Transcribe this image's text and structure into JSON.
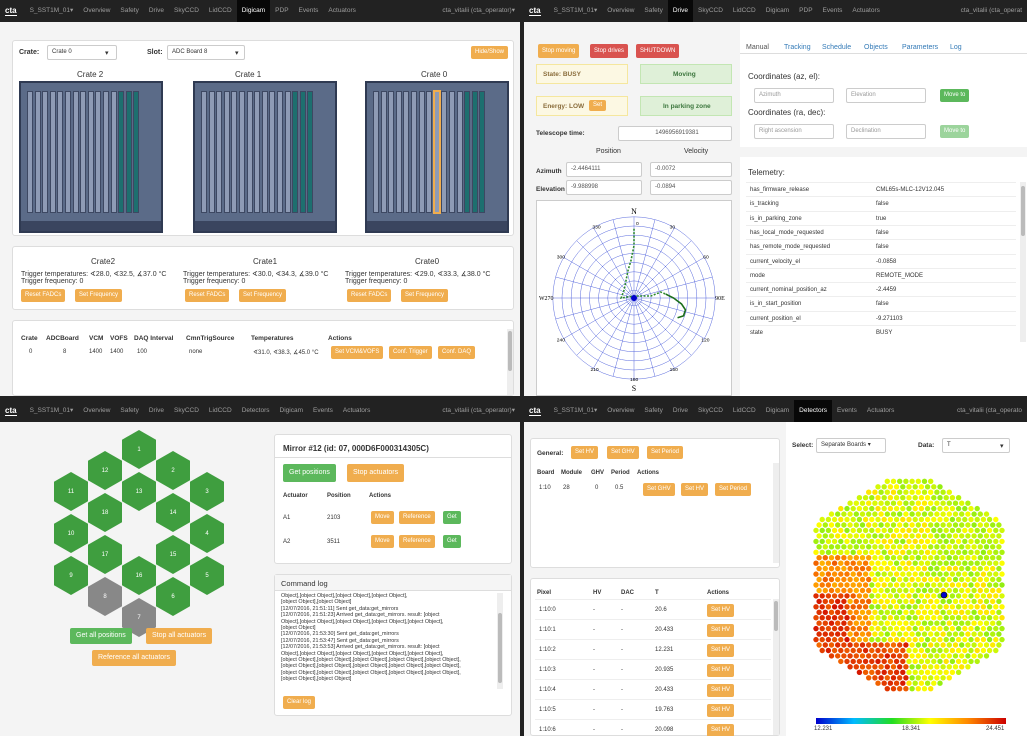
{
  "brand": "cta",
  "q1": {
    "nav": {
      "telescope": "S_SST1M_01▾",
      "items": [
        "Overview",
        "Safety",
        "Drive",
        "SkyCCD",
        "LidCCD",
        "Digicam",
        "PDP",
        "Events",
        "Actuators"
      ],
      "active": "Digicam",
      "user": "cta_vitalii (cta_operator)▾"
    },
    "crate_label": "Crate:",
    "crate_value": "Crate 0",
    "slot_label": "Slot:",
    "slot_value": "ADC Board 8",
    "hide_show": "Hide/Show",
    "crates": [
      "Crate 2",
      "Crate 1",
      "Crate 0"
    ],
    "crate_info": [
      {
        "name": "Crate2",
        "temps": "Trigger temperatures: ∢28.0, ∢32.5, ∡37.0 °C",
        "freq": "Trigger frequency: 0"
      },
      {
        "name": "Crate1",
        "temps": "Trigger temperatures: ∢30.0, ∢34.3, ∡39.0 °C",
        "freq": "Trigger frequency: 0"
      },
      {
        "name": "Crate0",
        "temps": "Trigger temperatures: ∢29.0, ∢33.3, ∡38.0 °C",
        "freq": "Trigger frequency: 0"
      }
    ],
    "reset_fadcs": "Reset FADCs",
    "set_frequency": "Set Frequency",
    "table_headers": [
      "Crate",
      "ADCBoard",
      "VCM",
      "VOFS",
      "DAQ Interval",
      "CmnTrigSource",
      "Temperatures",
      "Actions"
    ],
    "table_row": [
      "0",
      "8",
      "1400",
      "1400",
      "100",
      "none",
      "∢31.0, ∢38.3, ∡45.0 °C"
    ],
    "actions": [
      "Set VCM&VOFS",
      "Conf. Trigger",
      "Conf. DAQ"
    ]
  },
  "q2": {
    "nav": {
      "telescope": "S_SST1M_01▾",
      "items": [
        "Overview",
        "Safety",
        "Drive",
        "SkyCCD",
        "LidCCD",
        "Digicam",
        "PDP",
        "Events",
        "Actuators"
      ],
      "active": "Drive",
      "user": "cta_vitalii (cta_operat"
    },
    "stop_moving": "Stop moving",
    "stop_drives": "Stop drives",
    "shutdown": "SHUTDOWN",
    "state": "State: BUSY",
    "moving": "Moving",
    "energy": "Energy: LOW",
    "set": "Set",
    "parking": "In parking zone",
    "telescope_time_label": "Telescope time:",
    "telescope_time": "1496956919381",
    "pos_header": "Position",
    "vel_header": "Velocity",
    "azimuth_label": "Azimuth",
    "azimuth_pos": "-2.4464111",
    "azimuth_vel": "-0.0072",
    "elevation_label": "Elevation",
    "elevation_pos": "-9.988998",
    "elevation_vel": "-0.0894",
    "tabs": [
      "Manual",
      "Tracking",
      "Schedule",
      "Objects",
      "Parameters",
      "Log"
    ],
    "coord_azel": "Coordinates (az, el):",
    "azimuth_ph": "Azimuth",
    "elevation_ph": "Elevation",
    "move_to": "Move to",
    "coord_radec": "Coordinates (ra, dec):",
    "ra_ph": "Right ascension",
    "dec_ph": "Declination",
    "telemetry_title": "Telemetry:",
    "telemetry": [
      [
        "has_firmware_release",
        "CML65s-MLC-12V12.045"
      ],
      [
        "is_tracking",
        "false"
      ],
      [
        "is_in_parking_zone",
        "true"
      ],
      [
        "has_local_mode_requested",
        "false"
      ],
      [
        "has_remote_mode_requested",
        "false"
      ],
      [
        "current_velocity_el",
        "-0.0858"
      ],
      [
        "mode",
        "REMOTE_MODE"
      ],
      [
        "current_nominal_position_az",
        "-2.4459"
      ],
      [
        "is_in_start_position",
        "false"
      ],
      [
        "current_position_el",
        "-9.271103"
      ],
      [
        "state",
        "BUSY"
      ]
    ],
    "polar": {
      "N": "N",
      "S": "S",
      "E": "90E",
      "W": "W270",
      "labels": [
        "330",
        "30",
        "300",
        "60",
        "240",
        "120",
        "210",
        "150",
        "0",
        "180"
      ]
    }
  },
  "q3": {
    "nav": {
      "telescope": "S_SST1M_01▾",
      "items": [
        "Overview",
        "Safety",
        "Drive",
        "SkyCCD",
        "LidCCD",
        "Detectors",
        "Digicam",
        "Events",
        "Actuators"
      ],
      "active": "",
      "user": "cta_vitalii (cta_operator)▾"
    },
    "hex_ids": [
      "1",
      "12",
      "2",
      "11",
      "13",
      "3",
      "18",
      "14",
      "10",
      "4",
      "17",
      "15",
      "9",
      "16",
      "5",
      "8",
      "6",
      "7"
    ],
    "get_all": "Get all positions",
    "stop_all": "Stop all actuators",
    "ref_all": "Reference all actuators",
    "mirror_title": "Mirror #12 (id: 07, 000D6F000314305C)",
    "get_positions": "Get positions",
    "stop_actuators": "Stop actuators",
    "act_headers": [
      "Actuator",
      "Position",
      "Actions"
    ],
    "actuators": [
      {
        "name": "A1",
        "pos": "2103"
      },
      {
        "name": "A2",
        "pos": "3511"
      }
    ],
    "move": "Move",
    "reference": "Reference",
    "get": "Get",
    "cmd_title": "Command log",
    "log": [
      "Object],[object Object],[object Object],[object Object],",
      "[object Object],[object Object]",
      "[12/07/2016, 21:51:11] Sent get_data:get_mirrors",
      "[12/07/2016, 21:51:23] Arrived get_data:get_mirrors. result: [object",
      "Object],[object Object],[object Object],[object Object],[object Object],",
      "[object Object]",
      "[12/07/2016, 21:53:30] Sent get_data:get_mirrors",
      "[12/07/2016, 21:53:47] Sent get_data:get_mirrors",
      "[12/07/2016, 21:53:53] Arrived get_data:get_mirrors. result: [object",
      "Object],[object Object],[object Object],[object Object],[object Object],",
      "[object Object],[object Object],[object Object],[object Object],[object Object],",
      "[object Object],[object Object],[object Object],[object Object],[object Object],",
      "[object Object],[object Object],[object Object],[object Object],[object Object],",
      "[object Object],[object Object]"
    ],
    "clear_log": "Clear log"
  },
  "q4": {
    "nav": {
      "telescope": "S_SST1M_01▾",
      "items": [
        "Overview",
        "Safety",
        "Drive",
        "SkyCCD",
        "LidCCD",
        "Digicam",
        "Detectors",
        "Events",
        "Actuators"
      ],
      "active": "Detectors",
      "user": "cta_vitalii (cta_operato"
    },
    "general": "General:",
    "set_hv": "Set HV",
    "set_ghv": "Set GHV",
    "set_period": "Set Period",
    "board_headers": [
      "Board",
      "Module",
      "GHV",
      "Period",
      "Actions"
    ],
    "board_row": [
      "1:10",
      "28",
      "0",
      "0.5"
    ],
    "pixel_headers": [
      "Pixel",
      "HV",
      "DAC",
      "T",
      "Actions"
    ],
    "pixels": [
      [
        "1:10:0",
        "-",
        "-",
        "20.6"
      ],
      [
        "1:10:1",
        "-",
        "-",
        "20.433"
      ],
      [
        "1:10:2",
        "-",
        "-",
        "12.231"
      ],
      [
        "1:10:3",
        "-",
        "-",
        "20.935"
      ],
      [
        "1:10:4",
        "-",
        "-",
        "20.433"
      ],
      [
        "1:10:5",
        "-",
        "-",
        "19.763"
      ],
      [
        "1:10:6",
        "-",
        "-",
        "20.098"
      ]
    ],
    "select_label": "Select:",
    "select_value": "Separate Boards ▾",
    "data_label": "Data:",
    "data_value": "T",
    "scale": [
      "12.231",
      "18.341",
      "24.451"
    ]
  }
}
